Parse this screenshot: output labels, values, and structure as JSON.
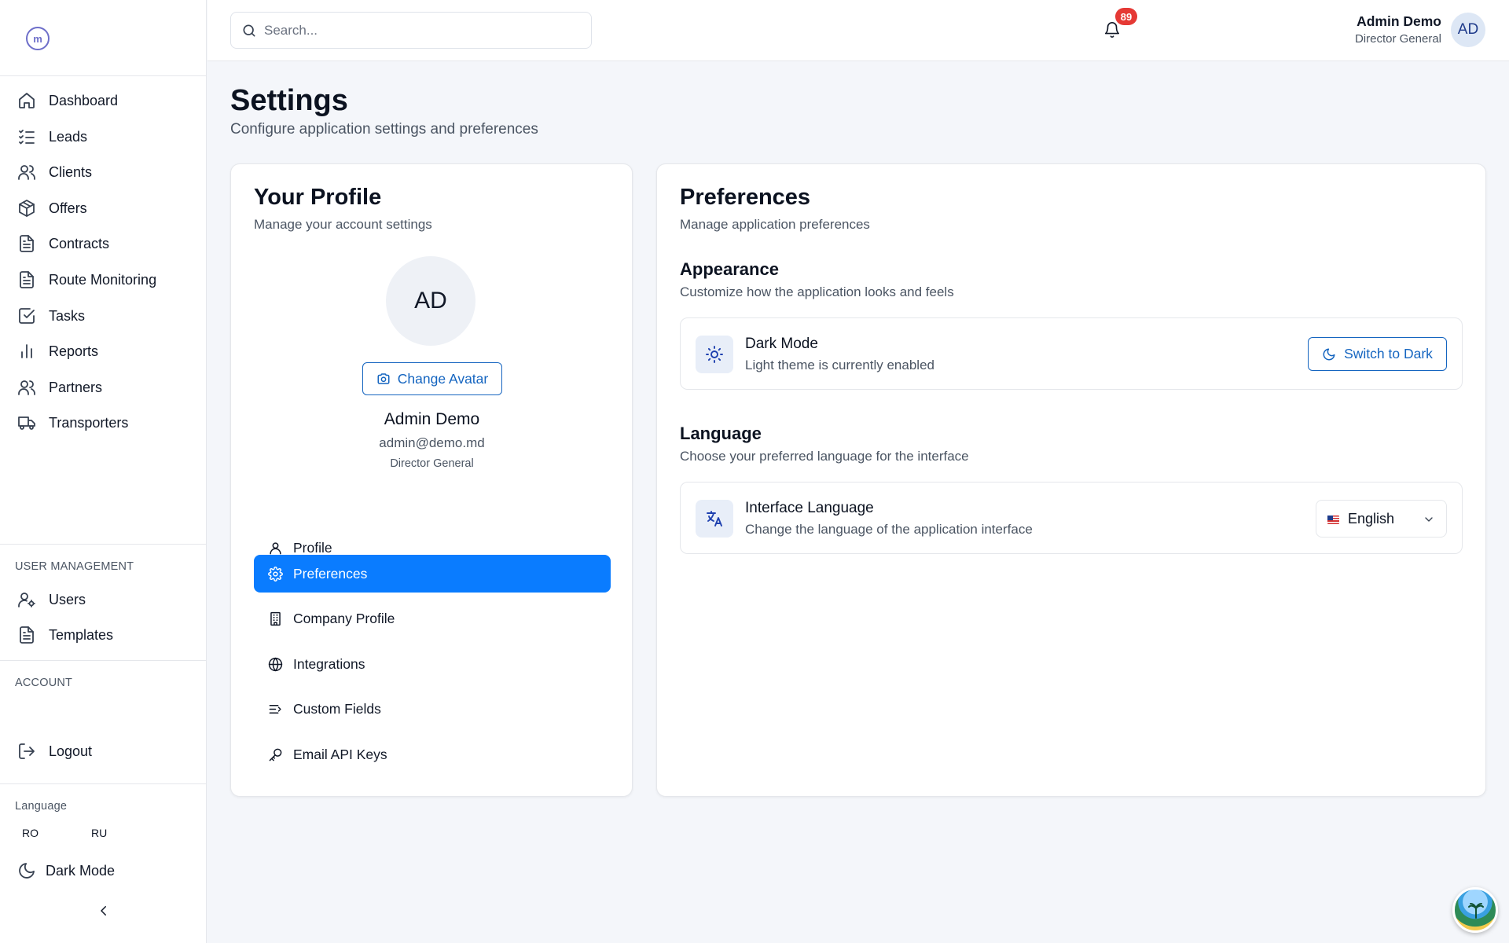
{
  "app": {
    "logo_text": "m"
  },
  "sidebar": {
    "nav": [
      {
        "label": "Dashboard",
        "icon": "home-icon"
      },
      {
        "label": "Leads",
        "icon": "list-check-icon"
      },
      {
        "label": "Clients",
        "icon": "users-icon"
      },
      {
        "label": "Offers",
        "icon": "package-icon"
      },
      {
        "label": "Contracts",
        "icon": "file-text-icon"
      },
      {
        "label": "Route Monitoring",
        "icon": "file-text-icon"
      },
      {
        "label": "Tasks",
        "icon": "checkbox-icon"
      },
      {
        "label": "Reports",
        "icon": "bar-chart-icon"
      },
      {
        "label": "Partners",
        "icon": "users-icon"
      },
      {
        "label": "Transporters",
        "icon": "truck-icon"
      }
    ],
    "user_management": {
      "title": "USER MANAGEMENT",
      "items": [
        {
          "label": "Users",
          "icon": "user-cog-icon"
        },
        {
          "label": "Templates",
          "icon": "file-text-icon"
        }
      ]
    },
    "account": {
      "title": "ACCOUNT",
      "logout": "Logout"
    },
    "language": {
      "title": "Language",
      "options": [
        "RO",
        "RU"
      ]
    },
    "dark_mode": "Dark Mode"
  },
  "topbar": {
    "search_placeholder": "Search...",
    "notifications_count": "89",
    "user_name": "Admin Demo",
    "user_role": "Director General",
    "avatar_initials": "AD"
  },
  "page": {
    "title": "Settings",
    "subtitle": "Configure application settings and preferences"
  },
  "profile": {
    "title": "Your Profile",
    "subtitle": "Manage your account settings",
    "avatar_initials": "AD",
    "change_avatar": "Change Avatar",
    "name": "Admin Demo",
    "email": "admin@demo.md",
    "role": "Director General",
    "menu": [
      {
        "label": "Profile",
        "icon": "user-icon",
        "active": false
      },
      {
        "label": "Preferences",
        "icon": "gear-icon",
        "active": true
      },
      {
        "label": "Company Profile",
        "icon": "building-icon",
        "active": false
      },
      {
        "label": "Integrations",
        "icon": "globe-icon",
        "active": false
      },
      {
        "label": "Custom Fields",
        "icon": "list-arrow-icon",
        "active": false
      },
      {
        "label": "Email API Keys",
        "icon": "key-icon",
        "active": false
      }
    ]
  },
  "preferences": {
    "title": "Preferences",
    "subtitle": "Manage application preferences",
    "appearance": {
      "title": "Appearance",
      "subtitle": "Customize how the application looks and feels",
      "dark_mode_name": "Dark Mode",
      "dark_mode_desc": "Light theme is currently enabled",
      "switch_button": "Switch to Dark"
    },
    "language": {
      "title": "Language",
      "subtitle": "Choose your preferred language for the interface",
      "name": "Interface Language",
      "desc": "Change the language of the application interface",
      "selected": "English"
    }
  },
  "colors": {
    "accent": "#0a7cff",
    "link": "#1565c0",
    "badge": "#e53935",
    "background": "#f4f6fa"
  }
}
